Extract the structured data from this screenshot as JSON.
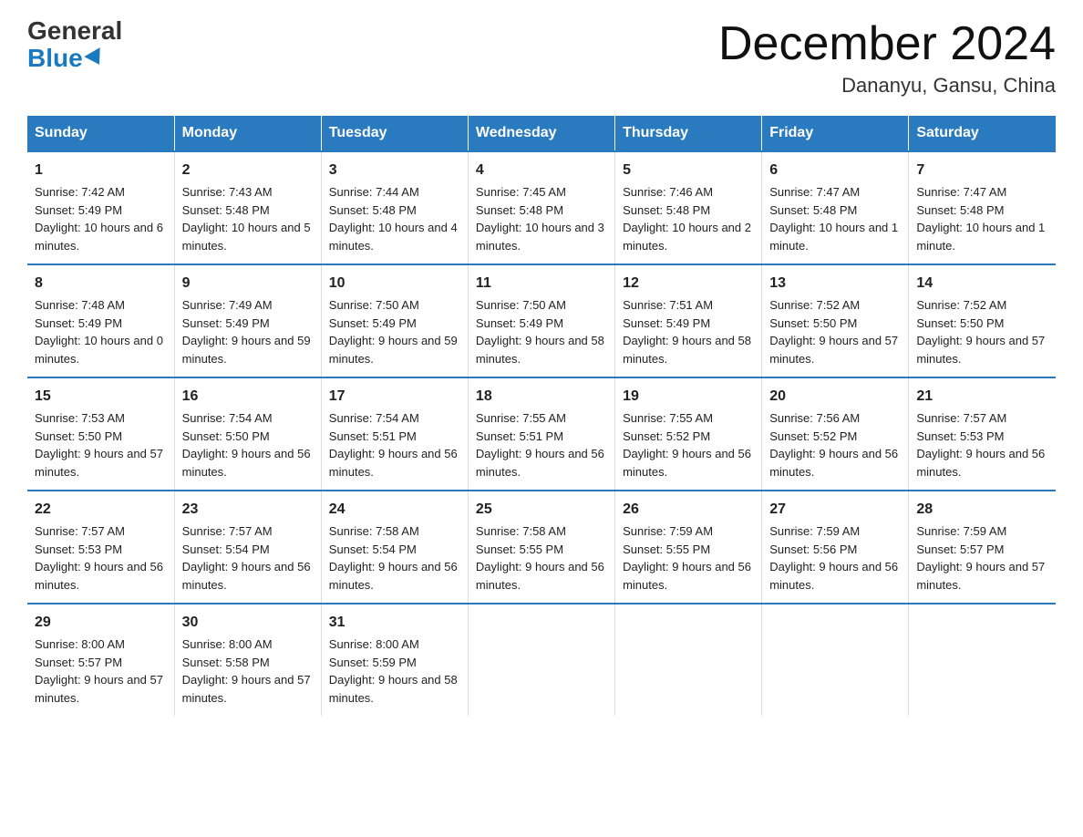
{
  "logo": {
    "general": "General",
    "blue": "Blue"
  },
  "header": {
    "month_year": "December 2024",
    "location": "Dananyu, Gansu, China"
  },
  "days_of_week": [
    "Sunday",
    "Monday",
    "Tuesday",
    "Wednesday",
    "Thursday",
    "Friday",
    "Saturday"
  ],
  "weeks": [
    [
      {
        "day": "1",
        "sunrise": "7:42 AM",
        "sunset": "5:49 PM",
        "daylight": "10 hours and 6 minutes."
      },
      {
        "day": "2",
        "sunrise": "7:43 AM",
        "sunset": "5:48 PM",
        "daylight": "10 hours and 5 minutes."
      },
      {
        "day": "3",
        "sunrise": "7:44 AM",
        "sunset": "5:48 PM",
        "daylight": "10 hours and 4 minutes."
      },
      {
        "day": "4",
        "sunrise": "7:45 AM",
        "sunset": "5:48 PM",
        "daylight": "10 hours and 3 minutes."
      },
      {
        "day": "5",
        "sunrise": "7:46 AM",
        "sunset": "5:48 PM",
        "daylight": "10 hours and 2 minutes."
      },
      {
        "day": "6",
        "sunrise": "7:47 AM",
        "sunset": "5:48 PM",
        "daylight": "10 hours and 1 minute."
      },
      {
        "day": "7",
        "sunrise": "7:47 AM",
        "sunset": "5:48 PM",
        "daylight": "10 hours and 1 minute."
      }
    ],
    [
      {
        "day": "8",
        "sunrise": "7:48 AM",
        "sunset": "5:49 PM",
        "daylight": "10 hours and 0 minutes."
      },
      {
        "day": "9",
        "sunrise": "7:49 AM",
        "sunset": "5:49 PM",
        "daylight": "9 hours and 59 minutes."
      },
      {
        "day": "10",
        "sunrise": "7:50 AM",
        "sunset": "5:49 PM",
        "daylight": "9 hours and 59 minutes."
      },
      {
        "day": "11",
        "sunrise": "7:50 AM",
        "sunset": "5:49 PM",
        "daylight": "9 hours and 58 minutes."
      },
      {
        "day": "12",
        "sunrise": "7:51 AM",
        "sunset": "5:49 PM",
        "daylight": "9 hours and 58 minutes."
      },
      {
        "day": "13",
        "sunrise": "7:52 AM",
        "sunset": "5:50 PM",
        "daylight": "9 hours and 57 minutes."
      },
      {
        "day": "14",
        "sunrise": "7:52 AM",
        "sunset": "5:50 PM",
        "daylight": "9 hours and 57 minutes."
      }
    ],
    [
      {
        "day": "15",
        "sunrise": "7:53 AM",
        "sunset": "5:50 PM",
        "daylight": "9 hours and 57 minutes."
      },
      {
        "day": "16",
        "sunrise": "7:54 AM",
        "sunset": "5:50 PM",
        "daylight": "9 hours and 56 minutes."
      },
      {
        "day": "17",
        "sunrise": "7:54 AM",
        "sunset": "5:51 PM",
        "daylight": "9 hours and 56 minutes."
      },
      {
        "day": "18",
        "sunrise": "7:55 AM",
        "sunset": "5:51 PM",
        "daylight": "9 hours and 56 minutes."
      },
      {
        "day": "19",
        "sunrise": "7:55 AM",
        "sunset": "5:52 PM",
        "daylight": "9 hours and 56 minutes."
      },
      {
        "day": "20",
        "sunrise": "7:56 AM",
        "sunset": "5:52 PM",
        "daylight": "9 hours and 56 minutes."
      },
      {
        "day": "21",
        "sunrise": "7:57 AM",
        "sunset": "5:53 PM",
        "daylight": "9 hours and 56 minutes."
      }
    ],
    [
      {
        "day": "22",
        "sunrise": "7:57 AM",
        "sunset": "5:53 PM",
        "daylight": "9 hours and 56 minutes."
      },
      {
        "day": "23",
        "sunrise": "7:57 AM",
        "sunset": "5:54 PM",
        "daylight": "9 hours and 56 minutes."
      },
      {
        "day": "24",
        "sunrise": "7:58 AM",
        "sunset": "5:54 PM",
        "daylight": "9 hours and 56 minutes."
      },
      {
        "day": "25",
        "sunrise": "7:58 AM",
        "sunset": "5:55 PM",
        "daylight": "9 hours and 56 minutes."
      },
      {
        "day": "26",
        "sunrise": "7:59 AM",
        "sunset": "5:55 PM",
        "daylight": "9 hours and 56 minutes."
      },
      {
        "day": "27",
        "sunrise": "7:59 AM",
        "sunset": "5:56 PM",
        "daylight": "9 hours and 56 minutes."
      },
      {
        "day": "28",
        "sunrise": "7:59 AM",
        "sunset": "5:57 PM",
        "daylight": "9 hours and 57 minutes."
      }
    ],
    [
      {
        "day": "29",
        "sunrise": "8:00 AM",
        "sunset": "5:57 PM",
        "daylight": "9 hours and 57 minutes."
      },
      {
        "day": "30",
        "sunrise": "8:00 AM",
        "sunset": "5:58 PM",
        "daylight": "9 hours and 57 minutes."
      },
      {
        "day": "31",
        "sunrise": "8:00 AM",
        "sunset": "5:59 PM",
        "daylight": "9 hours and 58 minutes."
      },
      null,
      null,
      null,
      null
    ]
  ],
  "labels": {
    "sunrise": "Sunrise:",
    "sunset": "Sunset:",
    "daylight": "Daylight:"
  }
}
